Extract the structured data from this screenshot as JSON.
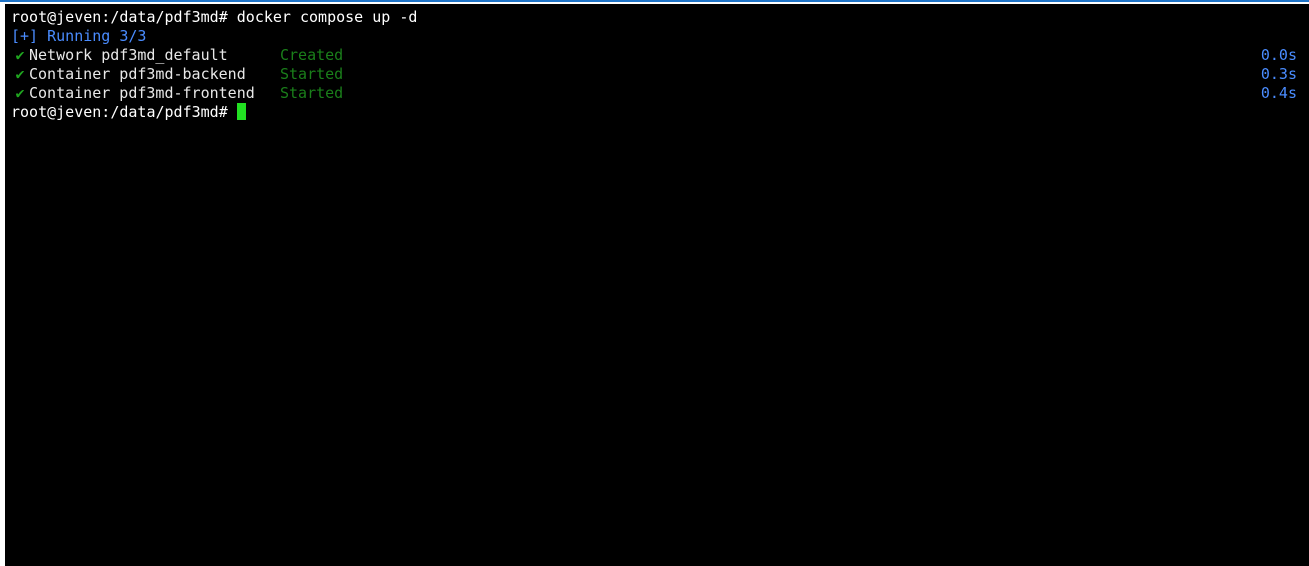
{
  "terminal": {
    "line1": {
      "prompt": "root@jeven:/data/pdf3md#",
      "command": " docker compose up -d"
    },
    "running": "[+] Running 3/3",
    "tasks": [
      {
        "check": "✔",
        "label": "Network pdf3md_default",
        "status": "Created",
        "time": "0.0s"
      },
      {
        "check": "✔",
        "label": "Container pdf3md-backend",
        "status": "Started",
        "time": "0.3s"
      },
      {
        "check": "✔",
        "label": "Container pdf3md-frontend",
        "status": "Started",
        "time": "0.4s"
      }
    ],
    "line_last": {
      "prompt": "root@jeven:/data/pdf3md#",
      "command": " "
    }
  },
  "colors": {
    "background": "#000000",
    "text": "#e8e8e8",
    "accent_blue": "#4a8cff",
    "ok_green": "#1a7f1a",
    "cursor_green": "#22e022",
    "window_border": "#1f74c8"
  }
}
